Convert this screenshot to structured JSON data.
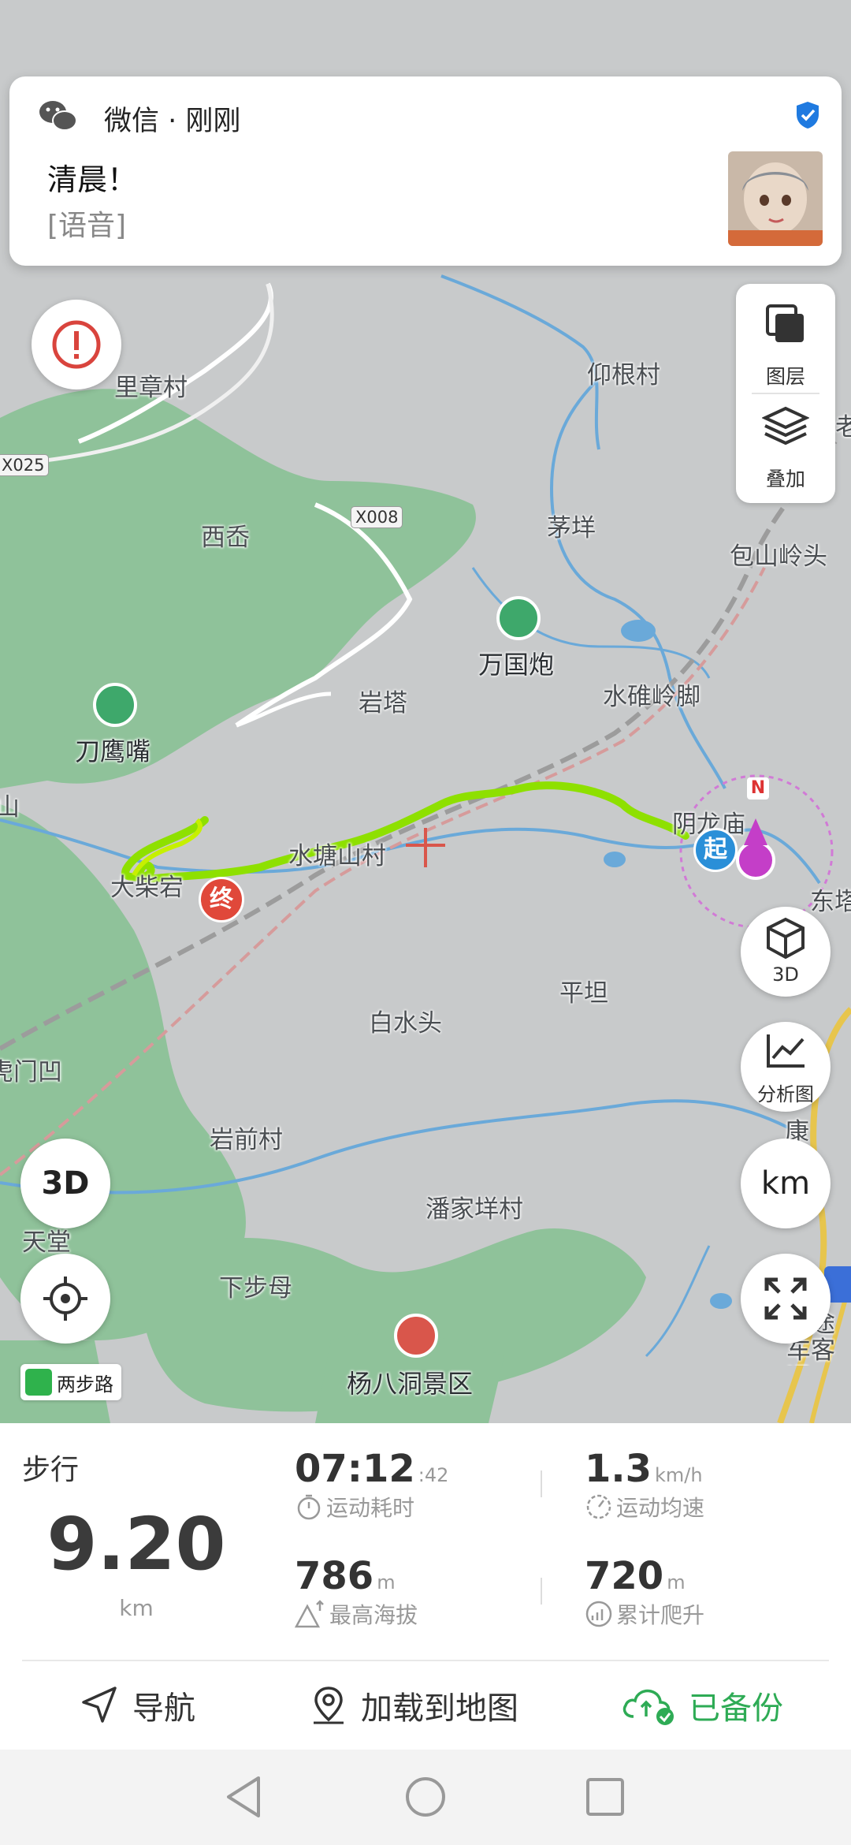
{
  "notification": {
    "app_name": "微信 · 刚刚",
    "title": "清晨！",
    "body": "[语音]"
  },
  "map": {
    "places": [
      {
        "name": "里章村"
      },
      {
        "name": "仰根村"
      },
      {
        "name": "X025"
      },
      {
        "name": "西岙"
      },
      {
        "name": "X008"
      },
      {
        "name": "茅垟"
      },
      {
        "name": "包山岭头"
      },
      {
        "name": "万国炮"
      },
      {
        "name": "岩塔"
      },
      {
        "name": "水碓岭脚"
      },
      {
        "name": "刀鹰嘴"
      },
      {
        "name": "阴龙庙"
      },
      {
        "name": "水塘山村"
      },
      {
        "name": "大柴宕"
      },
      {
        "name": "东塔"
      },
      {
        "name": "平坦"
      },
      {
        "name": "白水头"
      },
      {
        "name": "虎门凹"
      },
      {
        "name": "岩前村"
      },
      {
        "name": "康"
      },
      {
        "name": "潘家垟村"
      },
      {
        "name": "天堂"
      },
      {
        "name": "下步母"
      },
      {
        "name": "杨八洞景区"
      },
      {
        "name": "长途车客运"
      },
      {
        "name": "山"
      },
      {
        "name": "老"
      }
    ],
    "start_marker": "起",
    "end_marker": "终",
    "compass_label": "N",
    "controls": {
      "layers_label": "图层",
      "overlay_label": "叠加",
      "btn_3d_label": "3D",
      "analysis_label": "分析图",
      "unit_label": "km",
      "map3d_label": "3D"
    },
    "liangbu_label": "两步路"
  },
  "stats": {
    "mode": "步行",
    "distance": "9.20",
    "distance_unit": "km",
    "duration_main": "07:12",
    "duration_sec": ":42",
    "duration_caption": "运动耗时",
    "avg_speed": "1.3",
    "avg_speed_unit": "km/h",
    "avg_speed_caption": "运动均速",
    "max_alt": "786",
    "max_alt_unit": "m",
    "max_alt_caption": "最高海拔",
    "climb": "720",
    "climb_unit": "m",
    "climb_caption": "累计爬升"
  },
  "actions": {
    "navigate": "导航",
    "load_map": "加载到地图",
    "backup": "已备份"
  },
  "colors": {
    "track": "#8ee000",
    "forest": "#8fc29a",
    "water": "#6aa9d9",
    "accent_green": "#2eab55",
    "end_red": "#e0483a",
    "start_blue": "#2a8fd8",
    "me_purple": "#c43ec8"
  }
}
